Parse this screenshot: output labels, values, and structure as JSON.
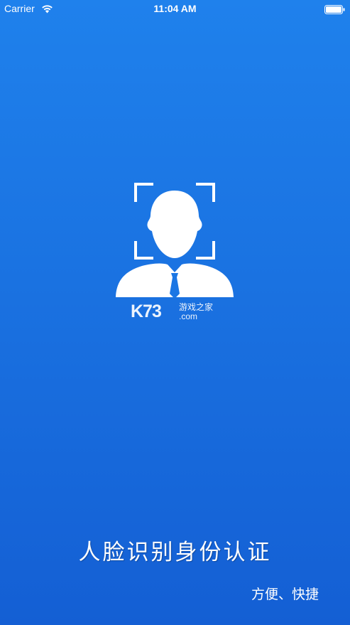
{
  "status_bar": {
    "carrier": "Carrier",
    "time": "11:04 AM"
  },
  "splash": {
    "icons": [
      "face-scan-frame-icon",
      "person-silhouette-icon"
    ],
    "watermark_brand": "K73",
    "watermark_cn": "游戏之家",
    "watermark_domain": ".com",
    "headline": "人脸识别身份认证",
    "subline": "方便、快捷"
  },
  "colors": {
    "background_top": "#1f81ec",
    "background_bottom": "#145fd4",
    "foreground": "#ffffff"
  }
}
